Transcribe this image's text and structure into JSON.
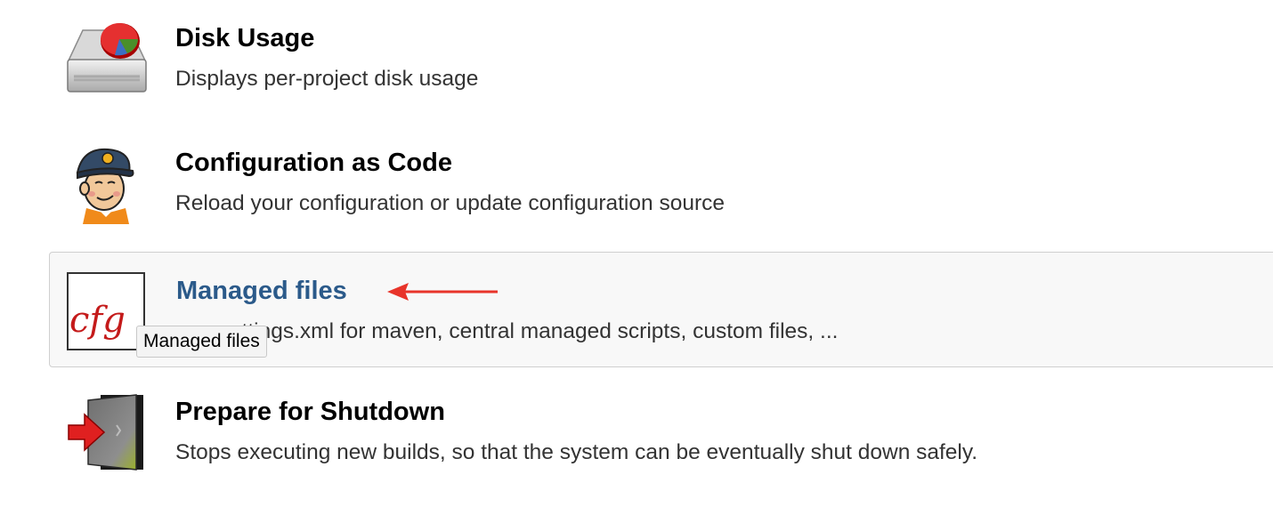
{
  "items": [
    {
      "title": "Disk Usage",
      "description": "Displays per-project disk usage",
      "icon": "disk-usage-icon"
    },
    {
      "title": "Configuration as Code",
      "description": "Reload your configuration or update configuration source",
      "icon": "jenkins-butler-icon"
    },
    {
      "title": "Managed files",
      "description": "e.g. settings.xml for maven, central managed scripts, custom files, ...",
      "icon": "cfg-icon",
      "icon_text": "cfg",
      "hovered": true
    },
    {
      "title": "Prepare for Shutdown",
      "description": "Stops executing new builds, so that the system can be eventually shut down safely.",
      "icon": "shutdown-door-icon"
    }
  ],
  "tooltip": "Managed files",
  "annotation": {
    "type": "arrow",
    "color": "#e8342a"
  },
  "colors": {
    "link_hover": "#2b5a8a",
    "text": "#000000",
    "description": "#333333"
  }
}
